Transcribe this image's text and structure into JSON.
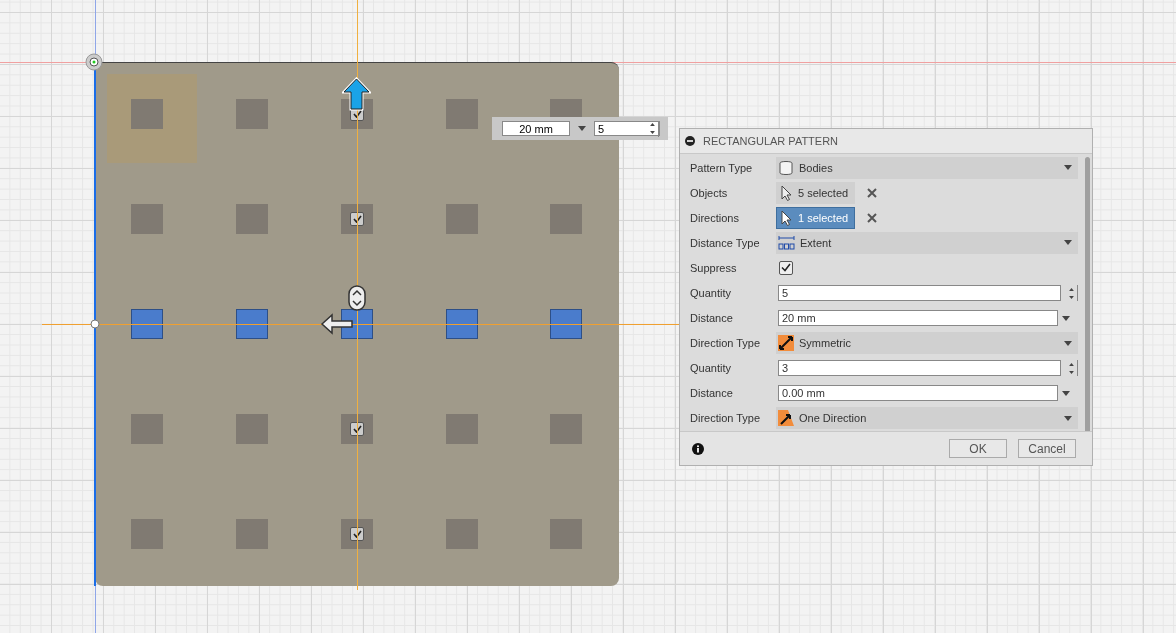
{
  "viewport": {
    "bodies": [
      {
        "kind": "instance"
      },
      {
        "kind": "instance"
      },
      {
        "kind": "toggle",
        "checked": true
      },
      {
        "kind": "instance"
      },
      {
        "kind": "instance"
      },
      {
        "kind": "instance"
      },
      {
        "kind": "instance"
      },
      {
        "kind": "toggle",
        "checked": true
      },
      {
        "kind": "instance"
      },
      {
        "kind": "instance"
      },
      {
        "kind": "selected"
      },
      {
        "kind": "selected"
      },
      {
        "kind": "selected"
      },
      {
        "kind": "selected"
      },
      {
        "kind": "selected"
      },
      {
        "kind": "instance"
      },
      {
        "kind": "instance"
      },
      {
        "kind": "toggle",
        "checked": true
      },
      {
        "kind": "instance"
      },
      {
        "kind": "instance"
      },
      {
        "kind": "instance"
      },
      {
        "kind": "instance"
      },
      {
        "kind": "toggle",
        "checked": true
      },
      {
        "kind": "instance"
      },
      {
        "kind": "instance"
      }
    ],
    "manipulator": {
      "distance": "20 mm",
      "quantity": "5"
    }
  },
  "dialog": {
    "title": "RECTANGULAR PATTERN",
    "rows": [
      {
        "kind": "dropdown",
        "label": "Pattern Type",
        "value": "Bodies"
      },
      {
        "kind": "selection",
        "label": "Objects",
        "value": "5 selected",
        "selected": false
      },
      {
        "kind": "selection",
        "label": "Directions",
        "value": "1 selected",
        "selected": true
      },
      {
        "kind": "dropdown",
        "label": "Distance Type",
        "value": "Extent"
      },
      {
        "kind": "checkbox",
        "label": "Suppress",
        "checked": true
      },
      {
        "kind": "spinner",
        "label": "Quantity",
        "value": "5"
      },
      {
        "kind": "input-dropdown",
        "label": "Distance",
        "value": "20 mm"
      },
      {
        "kind": "dropdown",
        "label": "Direction Type",
        "value": "Symmetric"
      },
      {
        "kind": "spinner",
        "label": "Quantity",
        "value": "3"
      },
      {
        "kind": "input-dropdown",
        "label": "Distance",
        "value": "0.00 mm"
      },
      {
        "kind": "dropdown",
        "label": "Direction Type",
        "value": "One Direction"
      }
    ],
    "buttons": [
      "OK",
      "Cancel"
    ]
  }
}
